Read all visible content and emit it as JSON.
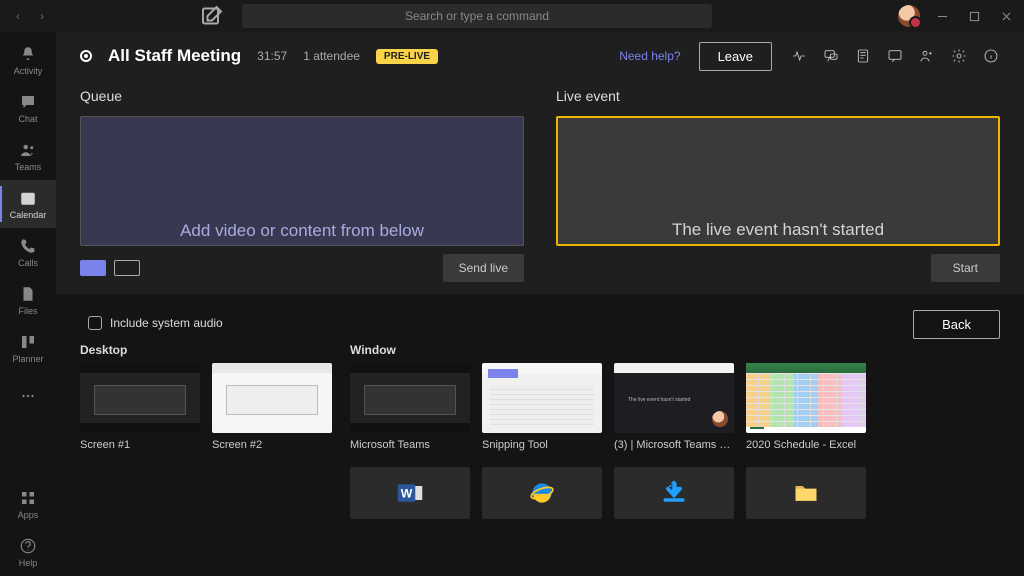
{
  "search": {
    "placeholder": "Search or type a command"
  },
  "rail": {
    "items": [
      {
        "label": "Activity"
      },
      {
        "label": "Chat"
      },
      {
        "label": "Teams"
      },
      {
        "label": "Calendar"
      },
      {
        "label": "Calls"
      },
      {
        "label": "Files"
      },
      {
        "label": "Planner"
      }
    ],
    "more": "...",
    "apps": "Apps",
    "help": "Help"
  },
  "meeting": {
    "title": "All Staff Meeting",
    "timer": "31:57",
    "attendees": "1 attendee",
    "badge": "PRE-LIVE",
    "need_help": "Need help?",
    "leave": "Leave"
  },
  "queue": {
    "title": "Queue",
    "placeholder": "Add video or content from below",
    "send_live": "Send live"
  },
  "live": {
    "title": "Live event",
    "placeholder": "The live event hasn't started",
    "start": "Start"
  },
  "tray": {
    "include_audio": "Include system audio",
    "back": "Back",
    "desktop_label": "Desktop",
    "window_label": "Window",
    "desktops": [
      {
        "label": "Screen #1"
      },
      {
        "label": "Screen #2"
      }
    ],
    "windows": [
      {
        "label": "Microsoft Teams"
      },
      {
        "label": "Snipping Tool"
      },
      {
        "label": "(3) | Microsoft Teams - W..."
      },
      {
        "label": "2020 Schedule - Excel"
      }
    ]
  }
}
